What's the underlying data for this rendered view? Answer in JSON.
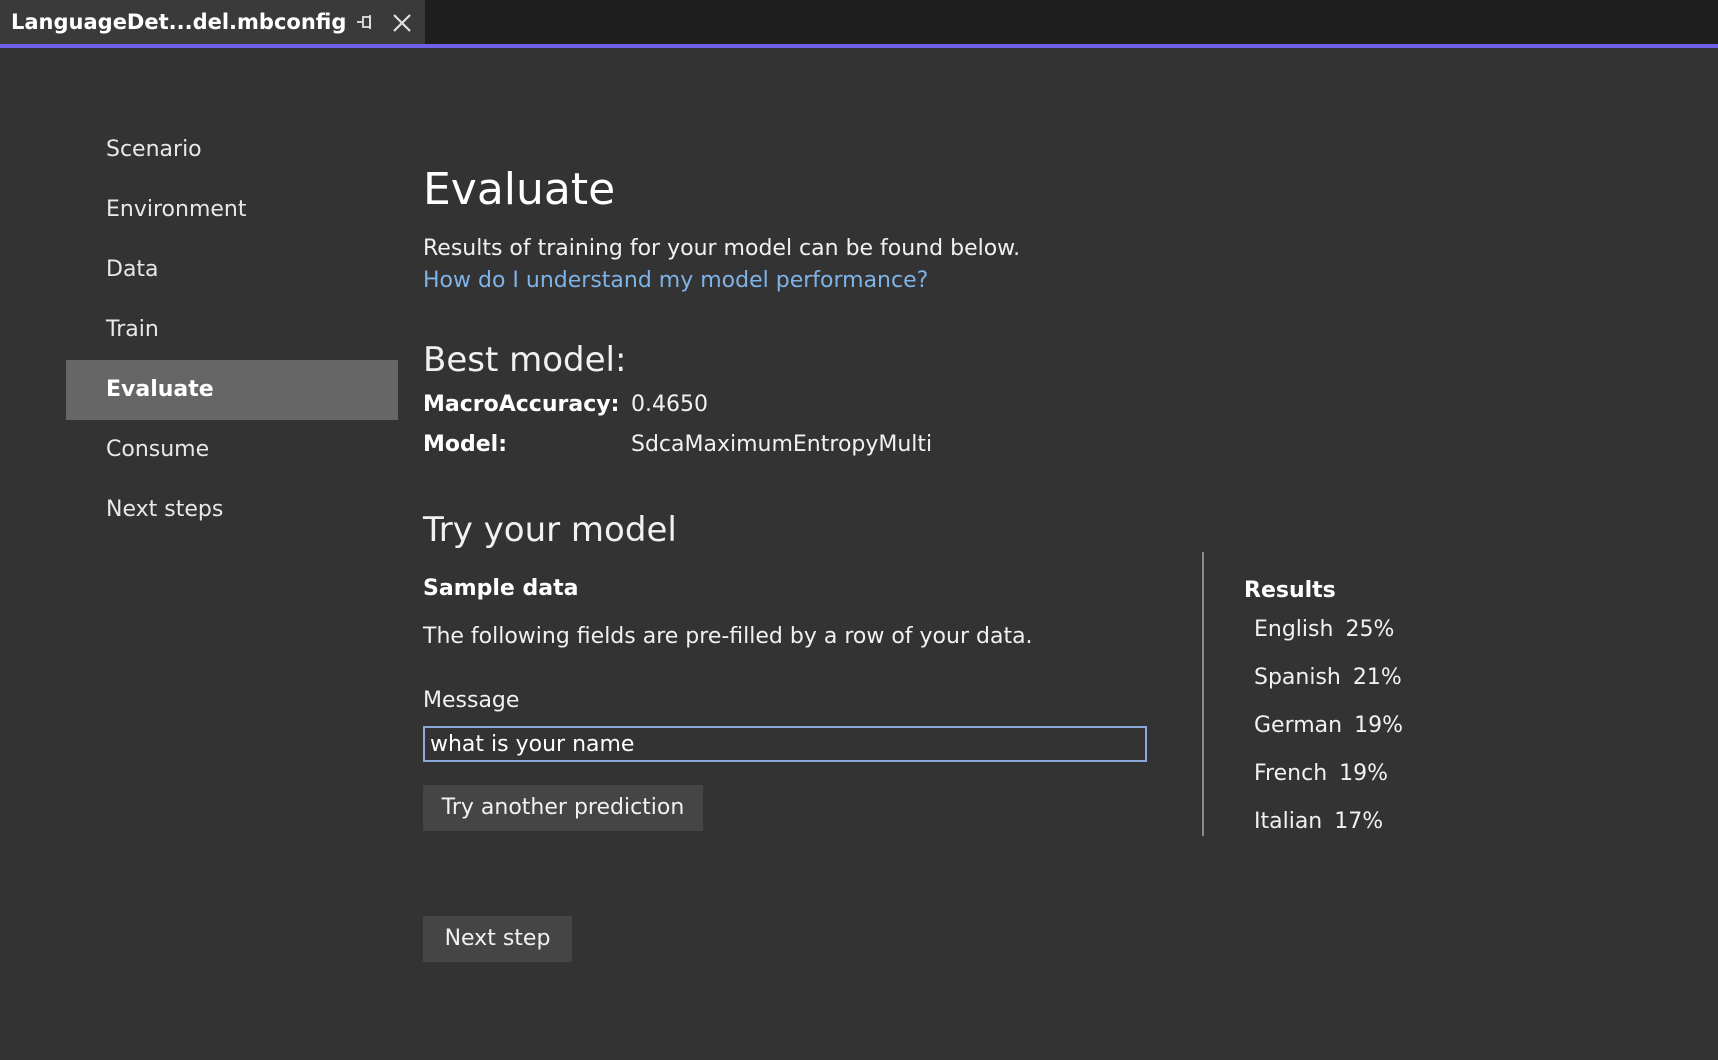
{
  "tab": {
    "title": "LanguageDet...del.mbconfig",
    "pin_icon": "pin-icon",
    "close_icon": "close-icon"
  },
  "colors": {
    "accent": "#7160e8",
    "link": "#7fb3e8",
    "nav_active": "#666666",
    "background": "#333333"
  },
  "nav": {
    "items": [
      {
        "label": "Scenario",
        "active": false
      },
      {
        "label": "Environment",
        "active": false
      },
      {
        "label": "Data",
        "active": false
      },
      {
        "label": "Train",
        "active": false
      },
      {
        "label": "Evaluate",
        "active": true
      },
      {
        "label": "Consume",
        "active": false
      },
      {
        "label": "Next steps",
        "active": false
      }
    ]
  },
  "main": {
    "title": "Evaluate",
    "subtitle": "Results of training for your model can be found below.",
    "help_link": "How do I understand my model performance?",
    "best_model": {
      "heading": "Best model:",
      "metric_label": "MacroAccuracy:",
      "metric_value": "0.4650",
      "model_label": "Model:",
      "model_value": "SdcaMaximumEntropyMulti"
    },
    "try_model": {
      "heading": "Try your model",
      "sample_heading": "Sample data",
      "sample_description": "The following fields are pre-filled by a row of your data.",
      "field_label": "Message",
      "field_value": "what is your name",
      "try_button": "Try another prediction"
    },
    "results": {
      "heading": "Results",
      "items": [
        {
          "language": "English",
          "percent": "25%"
        },
        {
          "language": "Spanish",
          "percent": "21%"
        },
        {
          "language": "German",
          "percent": "19%"
        },
        {
          "language": "French",
          "percent": "19%"
        },
        {
          "language": "Italian",
          "percent": "17%"
        }
      ]
    },
    "next_button": "Next step"
  }
}
